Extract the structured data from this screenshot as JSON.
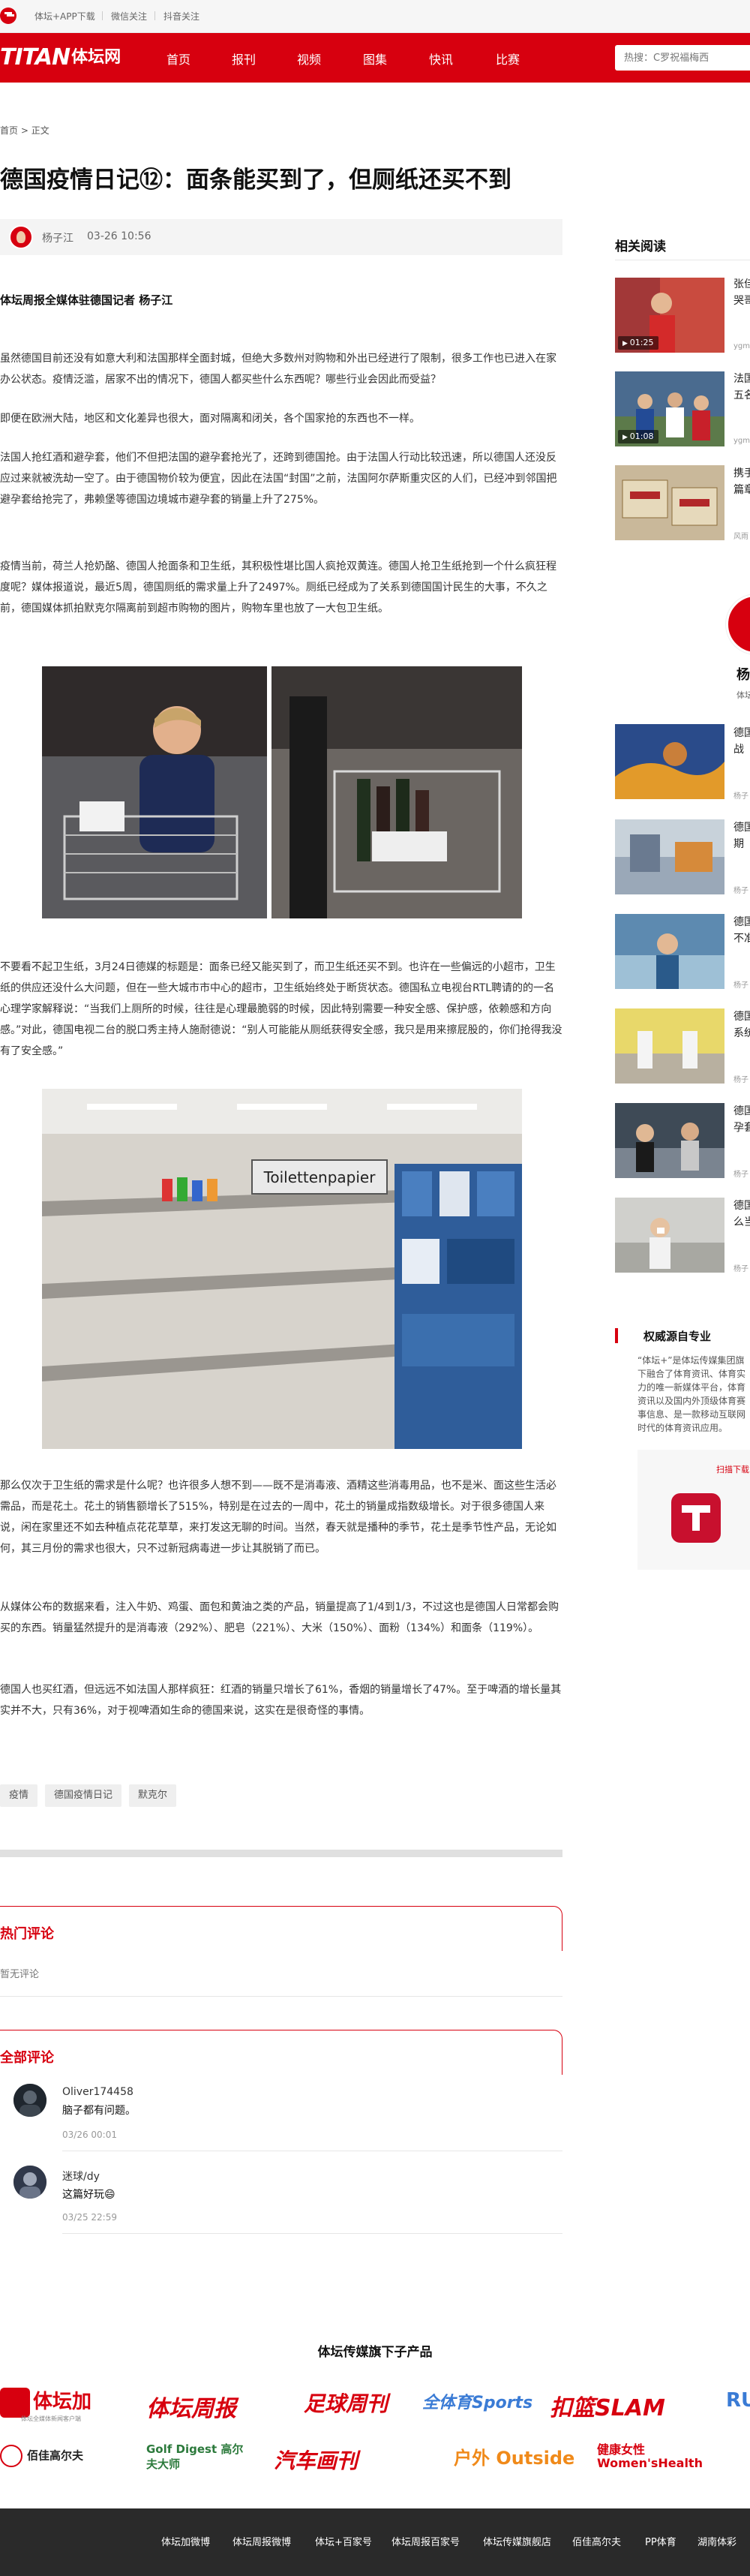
{
  "topbar": {
    "links": [
      "体坛+APP下载",
      "微信关注",
      "抖音关注"
    ]
  },
  "nav": {
    "brand_latin": "TITAN",
    "brand_cn": "体坛网",
    "items": [
      "首页",
      "报刊",
      "视频",
      "图集",
      "快讯",
      "比赛"
    ],
    "search_placeholder": "热搜：C罗祝福梅西"
  },
  "breadcrumb": {
    "home": "首页",
    "sep": ">",
    "current": "正文"
  },
  "article": {
    "title": "德国疫情日记⑫：面条能买到了，但厕纸还买不到",
    "author": "杨子江",
    "time": "03-26 10:56",
    "byline": "体坛周报全媒体驻德国记者 杨子江",
    "paragraphs": [
      "虽然德国目前还没有如意大利和法国那样全面封城，但绝大多数州对购物和外出已经进行了限制，很多工作也已进入在家办公状态。疫情泛滥，居家不出的情况下，德国人都买些什么东西呢？哪些行业会因此而受益？",
      "即便在欧洲大陆，地区和文化差异也很大，面对隔离和闭关，各个国家抢的东西也不一样。",
      "法国人抢红酒和避孕套，他们不但把法国的避孕套抢光了，还跨到德国抢。由于法国人行动比较迅速，所以德国人还没反应过来就被洗劫一空了。由于德国物价较为便宜，因此在法国“封国”之前，法国阿尔萨斯重灾区的人们，已经冲到邻国把避孕套给抢完了，弗赖堡等德国边境城市避孕套的销量上升了275%。",
      "疫情当前，荷兰人抢奶酪、德国人抢面条和卫生纸，其积极性堪比国人疯抢双黄连。德国人抢卫生纸抢到一个什么疯狂程度呢？媒体报道说，最近5周，德国厕纸的需求量上升了2497%。厕纸已经成为了关系到德国国计民生的大事，不久之前，德国媒体抓拍默克尔隔离前到超市购物的图片，购物车里也放了一大包卫生纸。",
      "不要看不起卫生纸，3月24日德媒的标题是：面条已经又能买到了，而卫生纸还买不到。也许在一些偏远的小超市，卫生纸的供应还没什么大问题，但在一些大城市市中心的超市，卫生纸始终处于断货状态。德国私立电视台RTL聘请的的一名心理学家解释说：“当我们上厕所的时候，往往是心理最脆弱的时候，因此特别需要一种安全感、保护感，依赖感和方向感。”对此，德国电视二台的脱口秀主持人施耐德说：“别人可能能从厕纸获得安全感，我只是用来擦屁股的，你们抢得我没有了安全感。”",
      "那么仅次于卫生纸的需求是什么呢？也许很多人想不到——既不是消毒液、酒精这些消毒用品，也不是米、面这些生活必需品，而是花土。花土的销售额增长了515%，特别是在过去的一周中，花土的销量成指数级增长。对于很多德国人来说，闲在家里还不如去种植点花花草草，来打发这无聊的时间。当然，春天就是播种的季节，花土是季节性产品，无论如何，其三月份的需求也很大，只不过新冠病毒进一步让其脱销了而已。",
      "从媒体公布的数据来看，注入牛奶、鸡蛋、面包和黄油之类的产品，销量提高了1/4到1/3，不过这也是德国人日常都会购买的东西。销量猛然提升的是消毒液（292%）、肥皂（221%）、大米（150%）、面粉（134%）和面条（119%）。",
      "德国人也买红酒，但远远不如法国人那样疯狂：红酒的销量只增长了61%，香烟的销量增长了47%。至于啤酒的增长量其实并不大，只有36%，对于视啤酒如生命的德国来说，这实在是很奇怪的事情。"
    ],
    "photo2_sign": "Toilettenpapier",
    "tags": [
      "疫情",
      "德国疫情日记",
      "默克尔"
    ]
  },
  "comments": {
    "hot_title": "热门评论",
    "hot_empty": "暂无评论",
    "all_title": "全部评论",
    "items": [
      {
        "name": "Oliver174458",
        "text": "脑子都有问题。",
        "time": "03/26 00:01"
      },
      {
        "name": "迷球/dy",
        "text": "这篇好玩😄",
        "time": "03/25 22:59"
      }
    ]
  },
  "sidebar": {
    "title": "相关阅读",
    "videos": [
      {
        "title": "张佳",
        "sub": "哭哥",
        "src": "ygm",
        "duration": "01:25"
      },
      {
        "title": "法国",
        "sub": "五名",
        "src": "ygm",
        "duration": "01:08"
      },
      {
        "title": "携手",
        "sub": "篇章",
        "src": "风雨",
        "duration": ""
      }
    ],
    "author_name": "杨子江",
    "author_role": "体坛传媒",
    "articles": [
      {
        "title": "德国",
        "sub": "战",
        "src": "杨子"
      },
      {
        "title": "德国",
        "sub": "期",
        "src": "杨子"
      },
      {
        "title": "德国",
        "sub": "不准",
        "src": "杨子"
      },
      {
        "title": "德国",
        "sub": "系统",
        "src": "杨子"
      },
      {
        "title": "德国",
        "sub": "孕套",
        "src": "杨子"
      },
      {
        "title": "德国",
        "sub": "么当",
        "src": "杨子"
      }
    ],
    "auth_title": "权威源自专业",
    "auth_desc": "“体坛+”是体坛传媒集团旗下融合了体育资讯、体育实力的唯一新媒体平台，体育资讯以及国内外顶级体育赛事信息、是一款移动互联网时代的体育资讯应用。",
    "qr_hint": "扫描下载"
  },
  "brands": {
    "title": "体坛传媒旗下子产品",
    "row1": [
      "体坛加",
      "体坛周报",
      "足球周刊",
      "全体育Sports",
      "扣篮SLAM",
      "RUN"
    ],
    "row1_sub": "体坛全媒体新闻客户端",
    "row2": [
      "佰佳高尔夫",
      "Golf Digest 高尔夫大师",
      "汽车画刊",
      "户外 Outside",
      "健康女性 Women'sHealth"
    ],
    "row2_sub": "佰佳高尔夫"
  },
  "footer": {
    "links": [
      "体坛加微博",
      "体坛周报微博",
      "体坛+百家号",
      "体坛周报百家号",
      "体坛传媒旗舰店",
      "佰佳高尔夫",
      "PP体育",
      "湖南体彩"
    ]
  },
  "colors": {
    "brand_red": "#d7000f",
    "footer_bg": "#2a2a2a"
  }
}
